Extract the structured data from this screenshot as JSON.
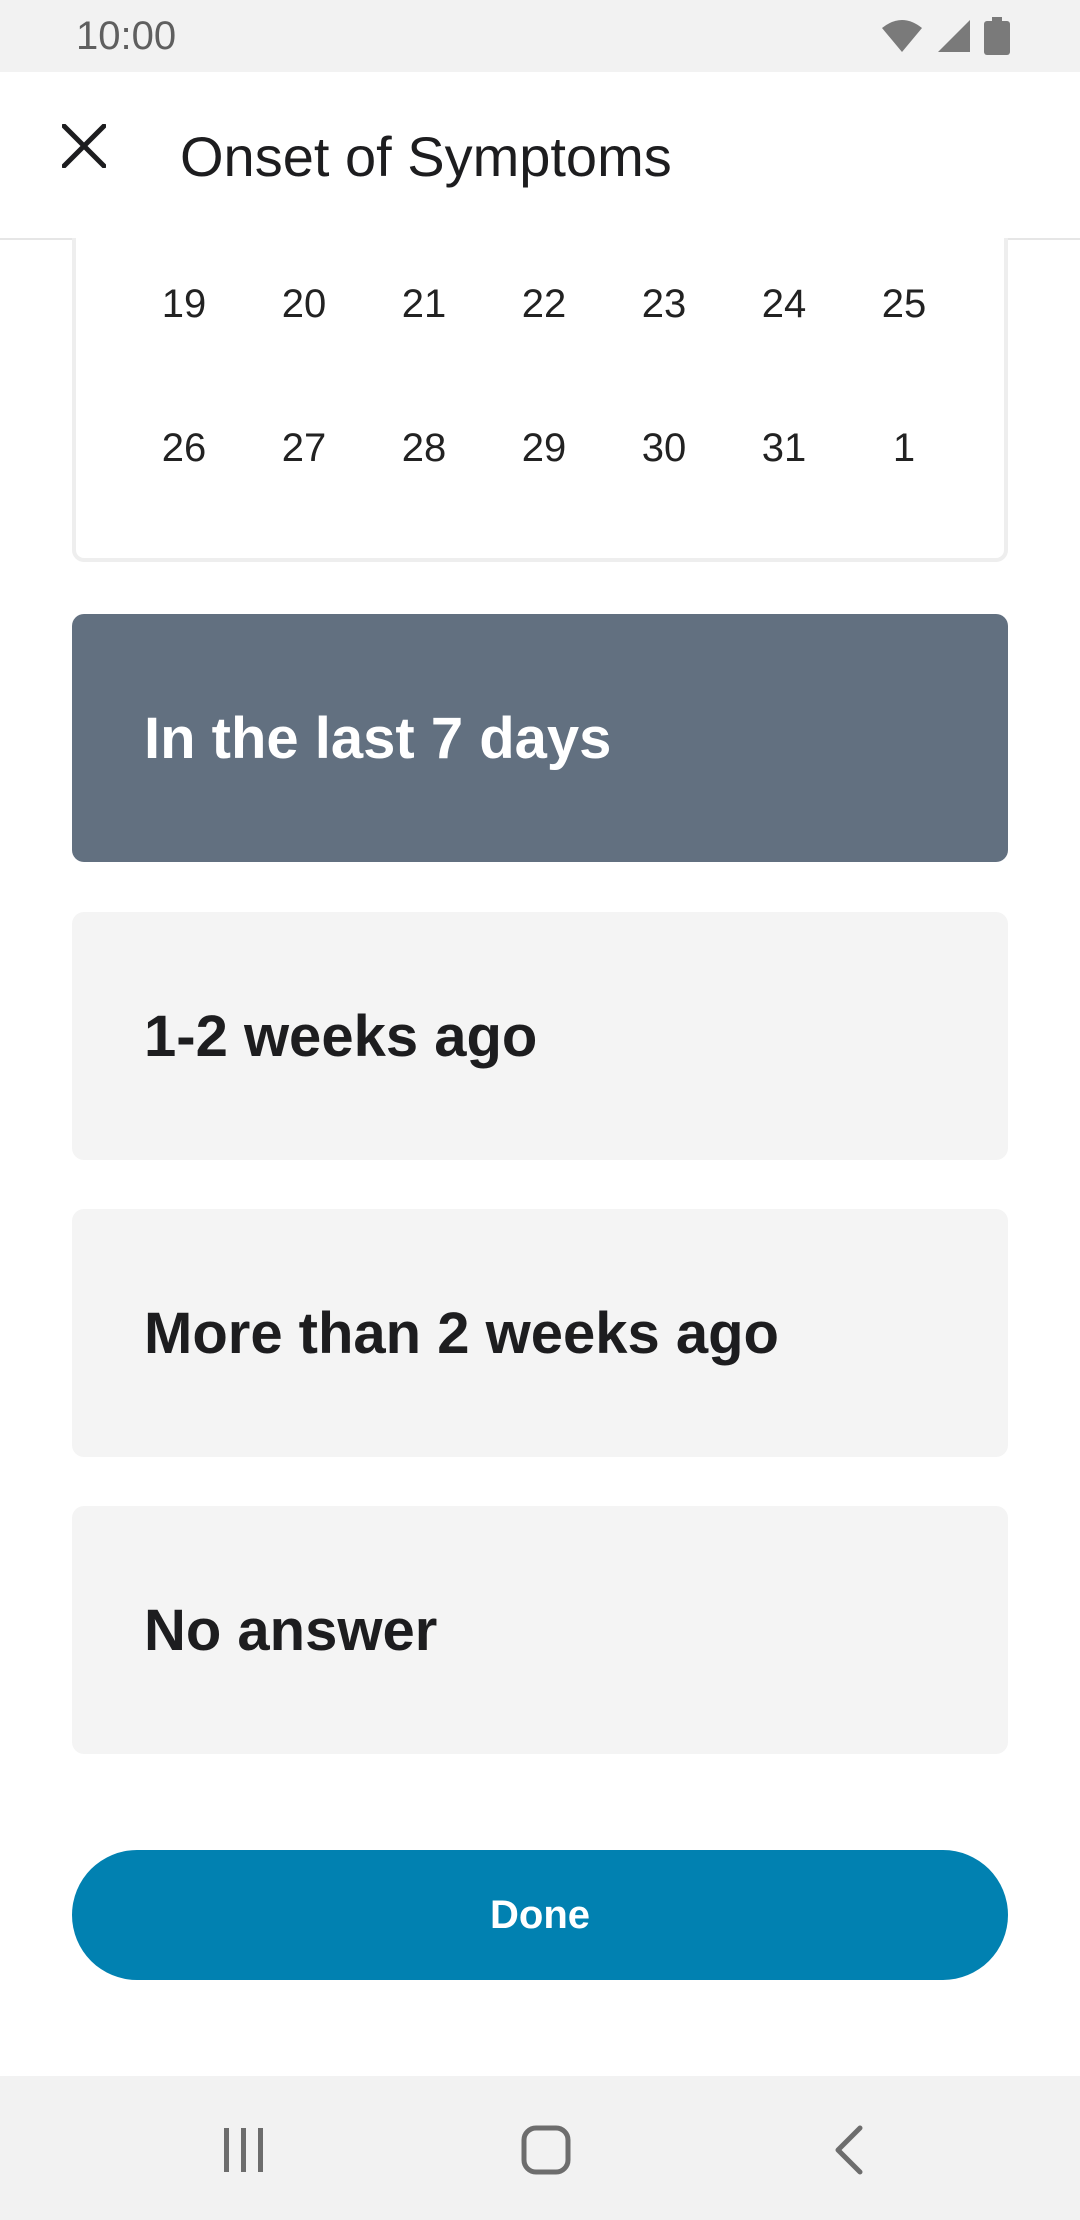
{
  "status_bar": {
    "time": "10:00",
    "icons": [
      "wifi-icon",
      "signal-icon",
      "battery-icon"
    ]
  },
  "app_bar": {
    "title": "Onset of Symptoms",
    "close_icon": "close-icon"
  },
  "calendar": {
    "weeks": [
      [
        "19",
        "20",
        "21",
        "22",
        "23",
        "24",
        "25"
      ],
      [
        "26",
        "27",
        "28",
        "29",
        "30",
        "31",
        "1"
      ]
    ]
  },
  "options": [
    {
      "label": "In the last 7 days",
      "selected": true
    },
    {
      "label": "1-2 weeks ago",
      "selected": false
    },
    {
      "label": "More than 2 weeks ago",
      "selected": false
    },
    {
      "label": "No answer",
      "selected": false
    }
  ],
  "done_button": {
    "label": "Done"
  },
  "colors": {
    "selected_option": "#627080",
    "option_background": "#f4f4f4",
    "primary_button": "#0181b1"
  },
  "nav_bar": {
    "icons": [
      "recent-apps-icon",
      "home-icon",
      "back-icon"
    ]
  }
}
